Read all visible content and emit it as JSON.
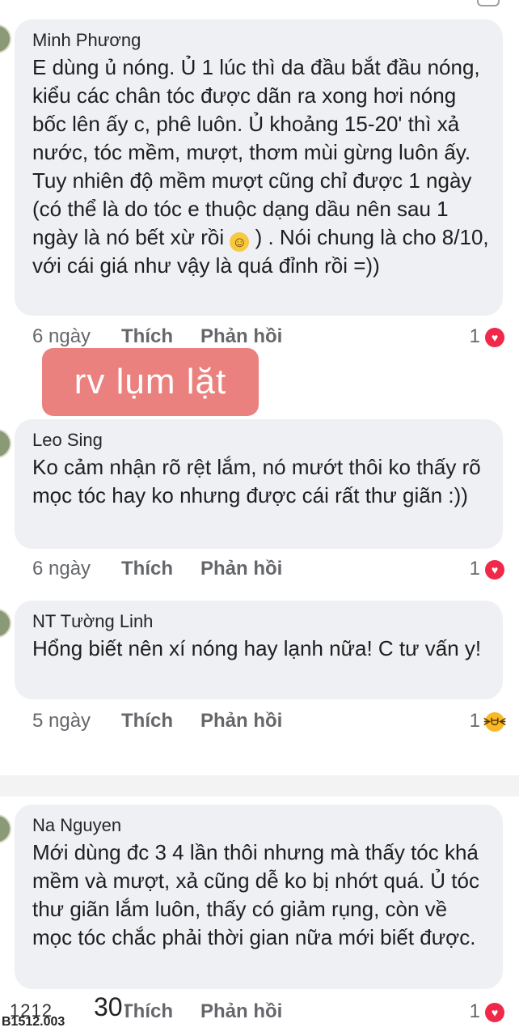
{
  "comments": [
    {
      "name": "Minh Phương",
      "text": "E dùng ủ nóng. Ủ 1 lúc thì da đầu bắt đầu nóng, kiểu các chân tóc được dãn ra xong hơi nóng bốc lên ấy c, phê luôn. Ủ khoảng 15-20' thì xả nước, tóc mềm, mượt, thơm mùi gừng luôn ấy. Tuy nhiên độ mềm mượt cũng chỉ được 1 ngày (có thể là do tóc e thuộc dạng dầu nên sau 1 ngày là nó bết xừ rồi",
      "text_tail": ") . Nói chung là cho 8/10, với cái giá như vậy là quá đỉnh rồi =))",
      "time": "6 ngày",
      "like": "Thích",
      "reply": "Phản hồi",
      "reaction_count": "1",
      "reaction": "heart-icon"
    },
    {
      "name": "Leo Sing",
      "text": "Ko cảm nhận rõ rệt lắm, nó mướt thôi ko thấy rõ mọc tóc hay ko nhưng được cái rất thư giãn :))",
      "time": "6 ngày",
      "like": "Thích",
      "reply": "Phản hồi",
      "reaction_count": "1",
      "reaction": "heart-icon"
    },
    {
      "name": "NT Tường Linh",
      "text": "Hổng biết nên xí nóng hay lạnh nữa! C tư vấn y!",
      "time": "5 ngày",
      "like": "Thích",
      "reply": "Phản hồi",
      "reaction_count": "1",
      "reaction": "haha-icon"
    },
    {
      "name": "Na Nguyen",
      "text": "Mới dùng đc 3 4 lần thôi nhưng mà thấy tóc khá mềm và mượt, xả cũng dễ ko bị nhớt quá. Ủ tóc thư giãn lắm luôn, thấy có giảm rụng, còn về mọc tóc chắc phải thời gian nữa mới biết được.",
      "like": "Thích",
      "reply": "Phản hồi",
      "reaction_count": "1",
      "reaction": "heart-icon"
    }
  ],
  "stamp": {
    "label": "rv lụm lặt"
  },
  "watermark": {
    "code": "B1512.003",
    "scribble": "1212",
    "number": "30"
  },
  "colors": {
    "bubble": "#eef0f3",
    "heart": "#f02849",
    "haha": "#f7b928",
    "stamp": "#e8706c"
  }
}
